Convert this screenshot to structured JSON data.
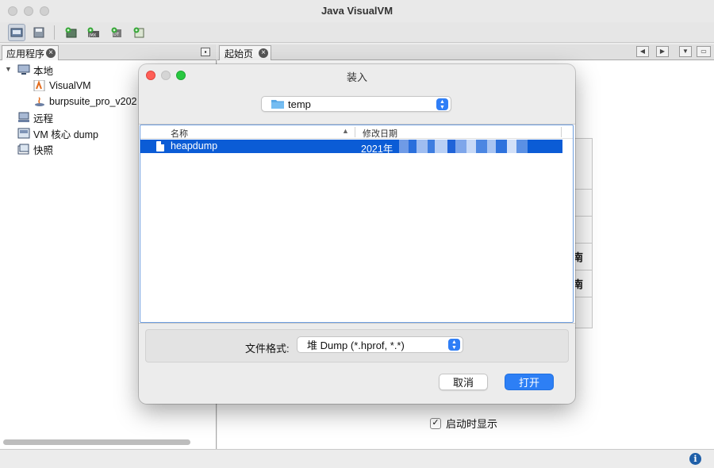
{
  "window": {
    "title": "Java VisualVM"
  },
  "toolbar": {
    "buttons": [
      {
        "name": "add-application-icon"
      },
      {
        "name": "save-snapshot-icon"
      },
      {
        "name": "add-jmx-connection-icon"
      },
      {
        "name": "add-remote-host-icon"
      },
      {
        "name": "load-snapshot-icon"
      },
      {
        "name": "add-coredump-icon"
      }
    ]
  },
  "left_panel": {
    "tab_label": "应用程序",
    "tree": [
      {
        "label": "本地",
        "icon": "computer-icon"
      },
      {
        "label": "VisualVM",
        "icon": "visualvm-icon"
      },
      {
        "label": "burpsuite_pro_v202",
        "icon": "java-icon"
      },
      {
        "label": "远程",
        "icon": "remote-icon"
      },
      {
        "label": "VM 核心 dump",
        "icon": "coredump-icon"
      },
      {
        "label": "快照",
        "icon": "snapshot-icon"
      }
    ]
  },
  "right_panel": {
    "tab_label": "起始页",
    "partial_texts": [
      "南",
      "南"
    ],
    "show_on_startup_label": "启动时显示"
  },
  "dialog": {
    "title": "装入",
    "directory": "temp",
    "columns": {
      "name": "名称",
      "date": "修改日期"
    },
    "files": [
      {
        "name": "heapdump",
        "date": "2021年"
      }
    ],
    "format_label": "文件格式:",
    "format_value": "堆 Dump (*.hprof, *.*)",
    "cancel_label": "取消",
    "open_label": "打开"
  },
  "colors": {
    "selection": "#0b5cd6",
    "primary_button": "#2d7ff5",
    "close_light": "#ff5f57",
    "minimize_light": "#febc2e",
    "zoom_light": "#28c840"
  }
}
